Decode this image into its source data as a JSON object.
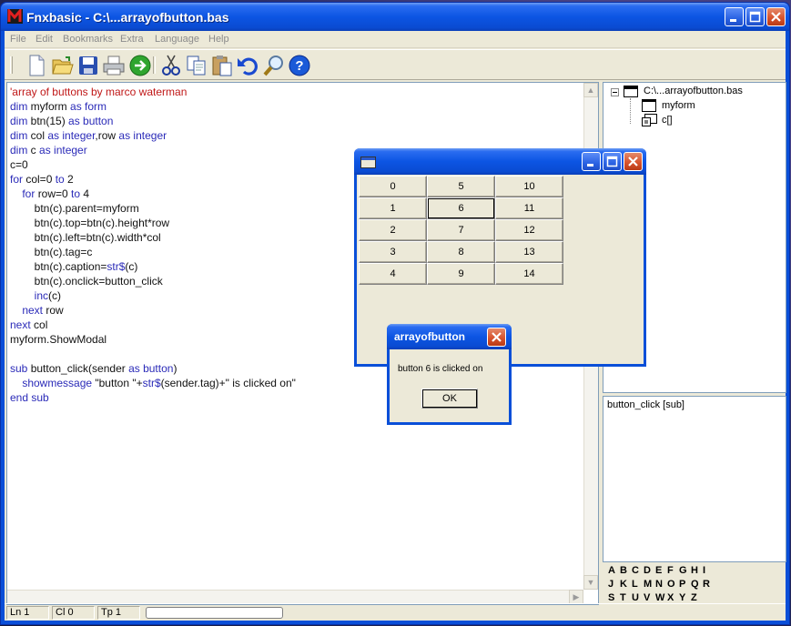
{
  "window": {
    "title": "Fnxbasic - C:\\...arrayofbutton.bas"
  },
  "menu": [
    "File",
    "Edit",
    "Bookmarks",
    "Extra",
    "Language",
    "Help"
  ],
  "toolbar": [
    "new-file-icon",
    "open-folder-icon",
    "save-icon",
    "print-icon",
    "run-icon",
    "cut-icon",
    "copy-icon",
    "paste-icon",
    "undo-icon",
    "find-icon",
    "help-icon"
  ],
  "code": [
    [
      [
        "'array of buttons by marco waterman",
        "r"
      ]
    ],
    [
      [
        "dim ",
        "k"
      ],
      [
        "myform ",
        "n"
      ],
      [
        "as form",
        "k"
      ]
    ],
    [
      [
        "dim ",
        "k"
      ],
      [
        "btn(15) ",
        "n"
      ],
      [
        "as button",
        "k"
      ]
    ],
    [
      [
        "dim ",
        "k"
      ],
      [
        "col ",
        "n"
      ],
      [
        "as integer",
        "k"
      ],
      [
        ",row ",
        "n"
      ],
      [
        "as integer",
        "k"
      ]
    ],
    [
      [
        "dim ",
        "k"
      ],
      [
        "c ",
        "n"
      ],
      [
        "as integer",
        "k"
      ]
    ],
    [
      [
        "c=0",
        "n"
      ]
    ],
    [
      [
        "for ",
        "k"
      ],
      [
        "col=0 ",
        "n"
      ],
      [
        "to ",
        "k"
      ],
      [
        "2",
        "n"
      ]
    ],
    [
      [
        "    for ",
        "k"
      ],
      [
        "row=0 ",
        "n"
      ],
      [
        "to ",
        "k"
      ],
      [
        "4",
        "n"
      ]
    ],
    [
      [
        "        btn(c).parent=myform",
        "n"
      ]
    ],
    [
      [
        "        btn(c).top=btn(c).height*row",
        "n"
      ]
    ],
    [
      [
        "        btn(c).left=btn(c).width*col",
        "n"
      ]
    ],
    [
      [
        "        btn(c).tag=c",
        "n"
      ]
    ],
    [
      [
        "        btn(c).caption=",
        "n"
      ],
      [
        "str$",
        "k"
      ],
      [
        "(c)",
        "n"
      ]
    ],
    [
      [
        "        btn(c).onclick=button_click",
        "n"
      ]
    ],
    [
      [
        "        inc",
        "k"
      ],
      [
        "(c)",
        "n"
      ]
    ],
    [
      [
        "    next ",
        "k"
      ],
      [
        "row",
        "n"
      ]
    ],
    [
      [
        "next ",
        "k"
      ],
      [
        "col",
        "n"
      ]
    ],
    [
      [
        "myform.ShowModal",
        "n"
      ]
    ],
    [
      [
        "",
        "n"
      ]
    ],
    [
      [
        "sub ",
        "k"
      ],
      [
        "button_click(sender ",
        "n"
      ],
      [
        "as button",
        "k"
      ],
      [
        ")",
        "n"
      ]
    ],
    [
      [
        "    showmessage ",
        "k"
      ],
      [
        "\"button \"+",
        "n"
      ],
      [
        "str$",
        "k"
      ],
      [
        "(sender.tag)+\" is clicked on\"",
        "n"
      ]
    ],
    [
      [
        "end sub",
        "k"
      ]
    ]
  ],
  "tree": {
    "root": "C:\\...arrayofbutton.bas",
    "children": [
      "myform",
      "c[]"
    ]
  },
  "members": [
    "button_click [sub]"
  ],
  "alphabet": [
    [
      "A",
      "B",
      "C",
      "D",
      "E",
      "F",
      "G",
      "H",
      "I"
    ],
    [
      "J",
      "K",
      "L",
      "M",
      "N",
      "O",
      "P",
      "Q",
      "R"
    ],
    [
      "S",
      "T",
      "U",
      "V",
      "W",
      "X",
      "Y",
      "Z"
    ]
  ],
  "status": {
    "ln": "Ln 1",
    "col": "Cl 0",
    "tp": "Tp 1",
    "progress": 0
  },
  "form": {
    "title": "",
    "buttons": [
      [
        "0",
        "5",
        "10"
      ],
      [
        "1",
        "6",
        "11"
      ],
      [
        "2",
        "7",
        "12"
      ],
      [
        "3",
        "8",
        "13"
      ],
      [
        "4",
        "9",
        "14"
      ]
    ],
    "focused": "6"
  },
  "message": {
    "title": "arrayofbutton",
    "text": "button 6 is clicked on",
    "ok": "OK"
  },
  "colors": {
    "titlebar": "#0a4fd8",
    "face": "#ece9d8",
    "keyword": "#2a2ab8",
    "comment": "#c01818"
  }
}
